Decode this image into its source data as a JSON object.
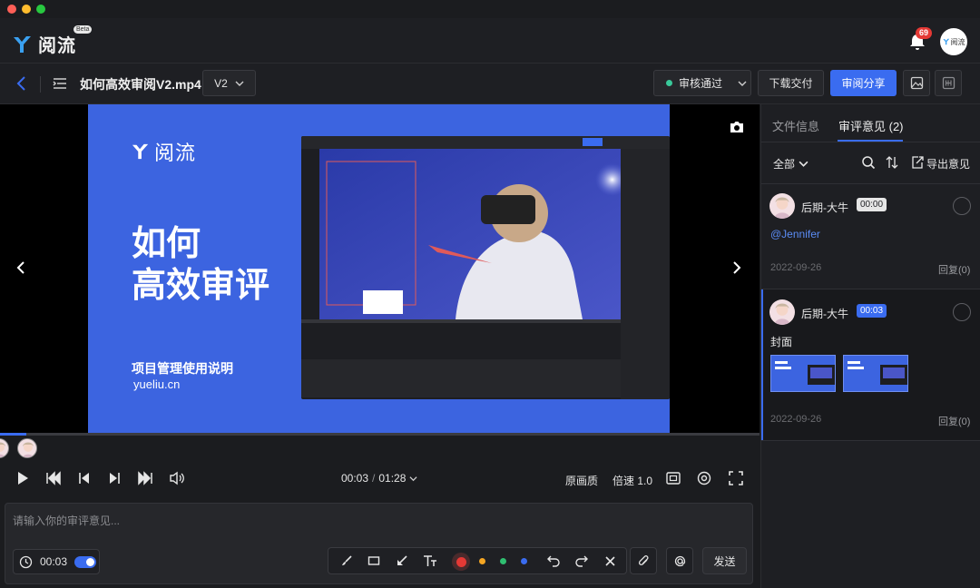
{
  "window": {
    "dots": [
      "#fe5f57",
      "#febc2e",
      "#28c840"
    ]
  },
  "header": {
    "logo_text": "阅流",
    "beta": "Beta",
    "notification_count": "69",
    "avatar_text": "阅流"
  },
  "toolbar": {
    "file_title": "如何高效审阅V2.mp4",
    "version": "V2",
    "status": "审核通过",
    "download": "下载交付",
    "share": "审阅分享"
  },
  "slide": {
    "logo_text": "阅流",
    "title_line1": "如何",
    "title_line2": "高效审评",
    "subtitle": "项目管理使用说明",
    "url": "yueliu.cn"
  },
  "player": {
    "progress": 0.035,
    "current_time": "00:03",
    "separator": "/",
    "total_time": "01:28",
    "quality": "原画质",
    "speed": "倍速 1.0"
  },
  "comment_input": {
    "placeholder": "请输入你的审评意见...",
    "timestamp": "00:03",
    "send": "发送",
    "colors": [
      "#e53935",
      "#f5a623",
      "#2fbf71",
      "#3a6cf0"
    ]
  },
  "panel": {
    "tab_file_info": "文件信息",
    "tab_comments": "审评意见 (2)",
    "filter": "全部",
    "export": "导出意见",
    "comments": [
      {
        "author": "后期-大牛",
        "time": "00:00",
        "text": "@Jennifer",
        "date": "2022-09-26",
        "reply": "回复(0)"
      },
      {
        "author": "后期-大牛",
        "time": "00:03",
        "text": "封面",
        "date": "2022-09-26",
        "reply": "回复(0)"
      }
    ]
  }
}
